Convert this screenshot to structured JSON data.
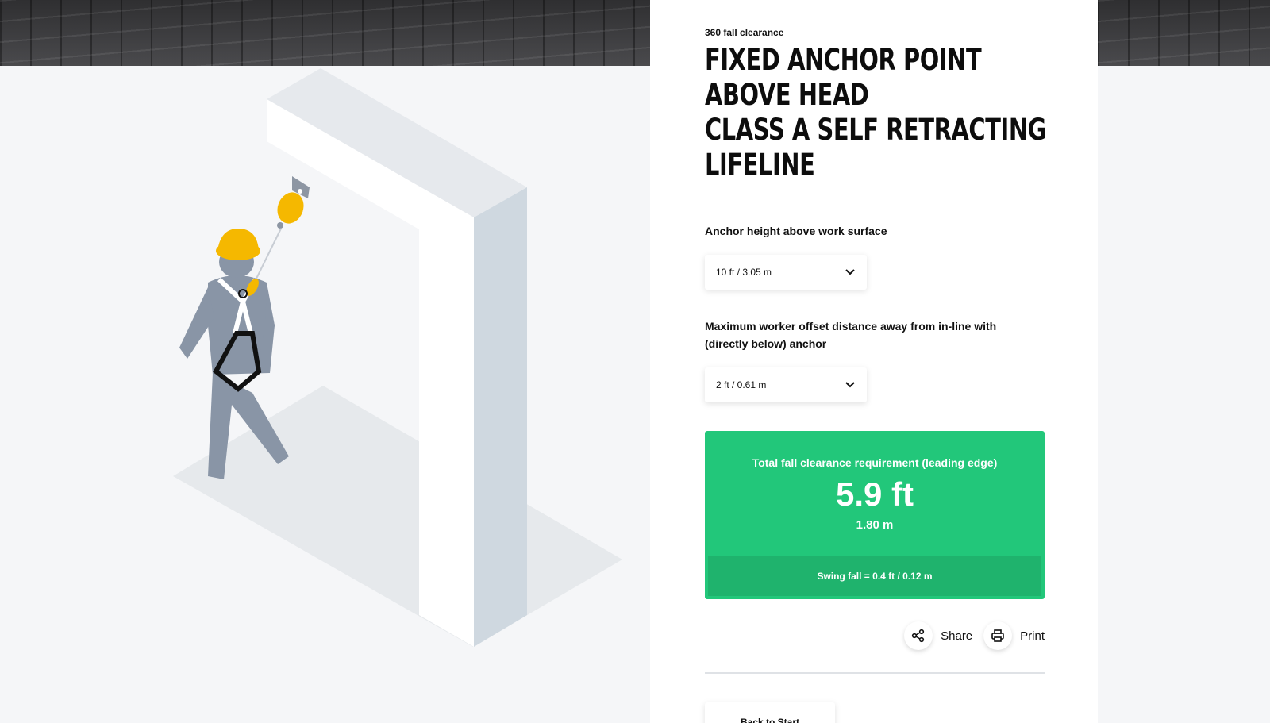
{
  "header": {
    "eyebrow": "360 fall clearance",
    "title_lines": [
      "FIXED ANCHOR POINT",
      "ABOVE HEAD",
      "CLASS A SELF RETRACTING",
      "LIFELINE"
    ]
  },
  "fields": {
    "anchor_height": {
      "label": "Anchor height above work surface",
      "value": "10 ft / 3.05 m"
    },
    "offset": {
      "label": "Maximum worker offset distance away from in-line with (directly below) anchor",
      "value": "2 ft / 0.61 m"
    }
  },
  "result": {
    "label": "Total fall clearance requirement (leading edge)",
    "value_ft": "5.9 ft",
    "value_m": "1.80 m",
    "swing_fall": "Swing fall = 0.4 ft / 0.12 m"
  },
  "actions": {
    "share": "Share",
    "print": "Print",
    "back": "Back to Start"
  },
  "colors": {
    "result_green": "#22c77a",
    "swing_green": "#1fb36d",
    "helmet_yellow": "#f5b800",
    "worker_gray": "#8995a6"
  }
}
